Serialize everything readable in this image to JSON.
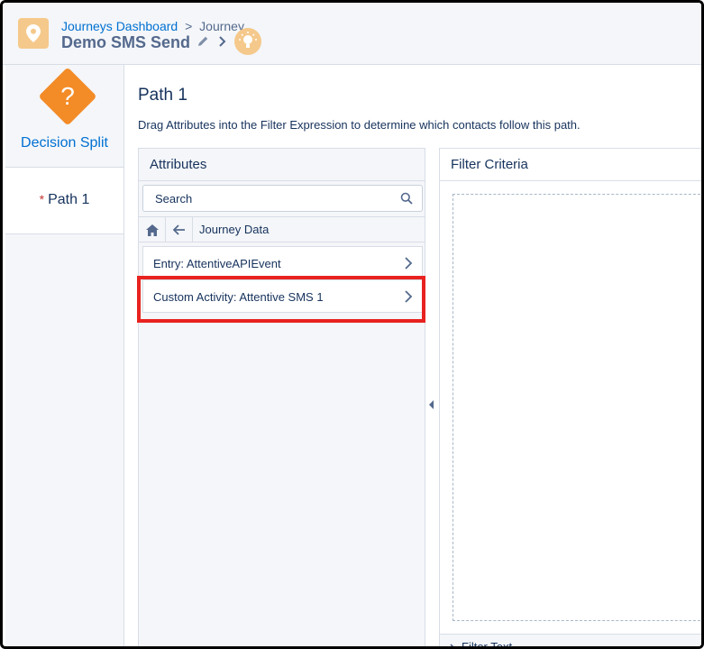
{
  "header": {
    "breadcrumb_link": "Journeys Dashboard",
    "breadcrumb_separator": ">",
    "breadcrumb_current": "Journey",
    "journey_name": "Demo SMS Send",
    "icons": [
      "map-pin-icon",
      "pencil-icon",
      "chevron-right-icon",
      "lightbulb-icon"
    ]
  },
  "sidebar": {
    "activity_label": "Decision Split",
    "activity_icon_glyph": "?",
    "path_required_marker": "*",
    "path_label": "Path 1"
  },
  "main": {
    "path_title": "Path 1",
    "description": "Drag Attributes into the Filter Expression to determine which contacts follow this path."
  },
  "attributes": {
    "title": "Attributes",
    "search_placeholder": "Search",
    "breadcrumb": "Journey Data",
    "items": [
      {
        "label": "Entry: AttentiveAPIEvent"
      },
      {
        "label": "Custom Activity: Attentive SMS 1"
      }
    ]
  },
  "filter": {
    "title": "Filter Criteria",
    "footer_label": "Filter Text"
  },
  "colors": {
    "accent": "#0070d2",
    "decision_orange": "#f38b27",
    "highlight_red": "#e8221f",
    "required_red": "#c23934"
  }
}
